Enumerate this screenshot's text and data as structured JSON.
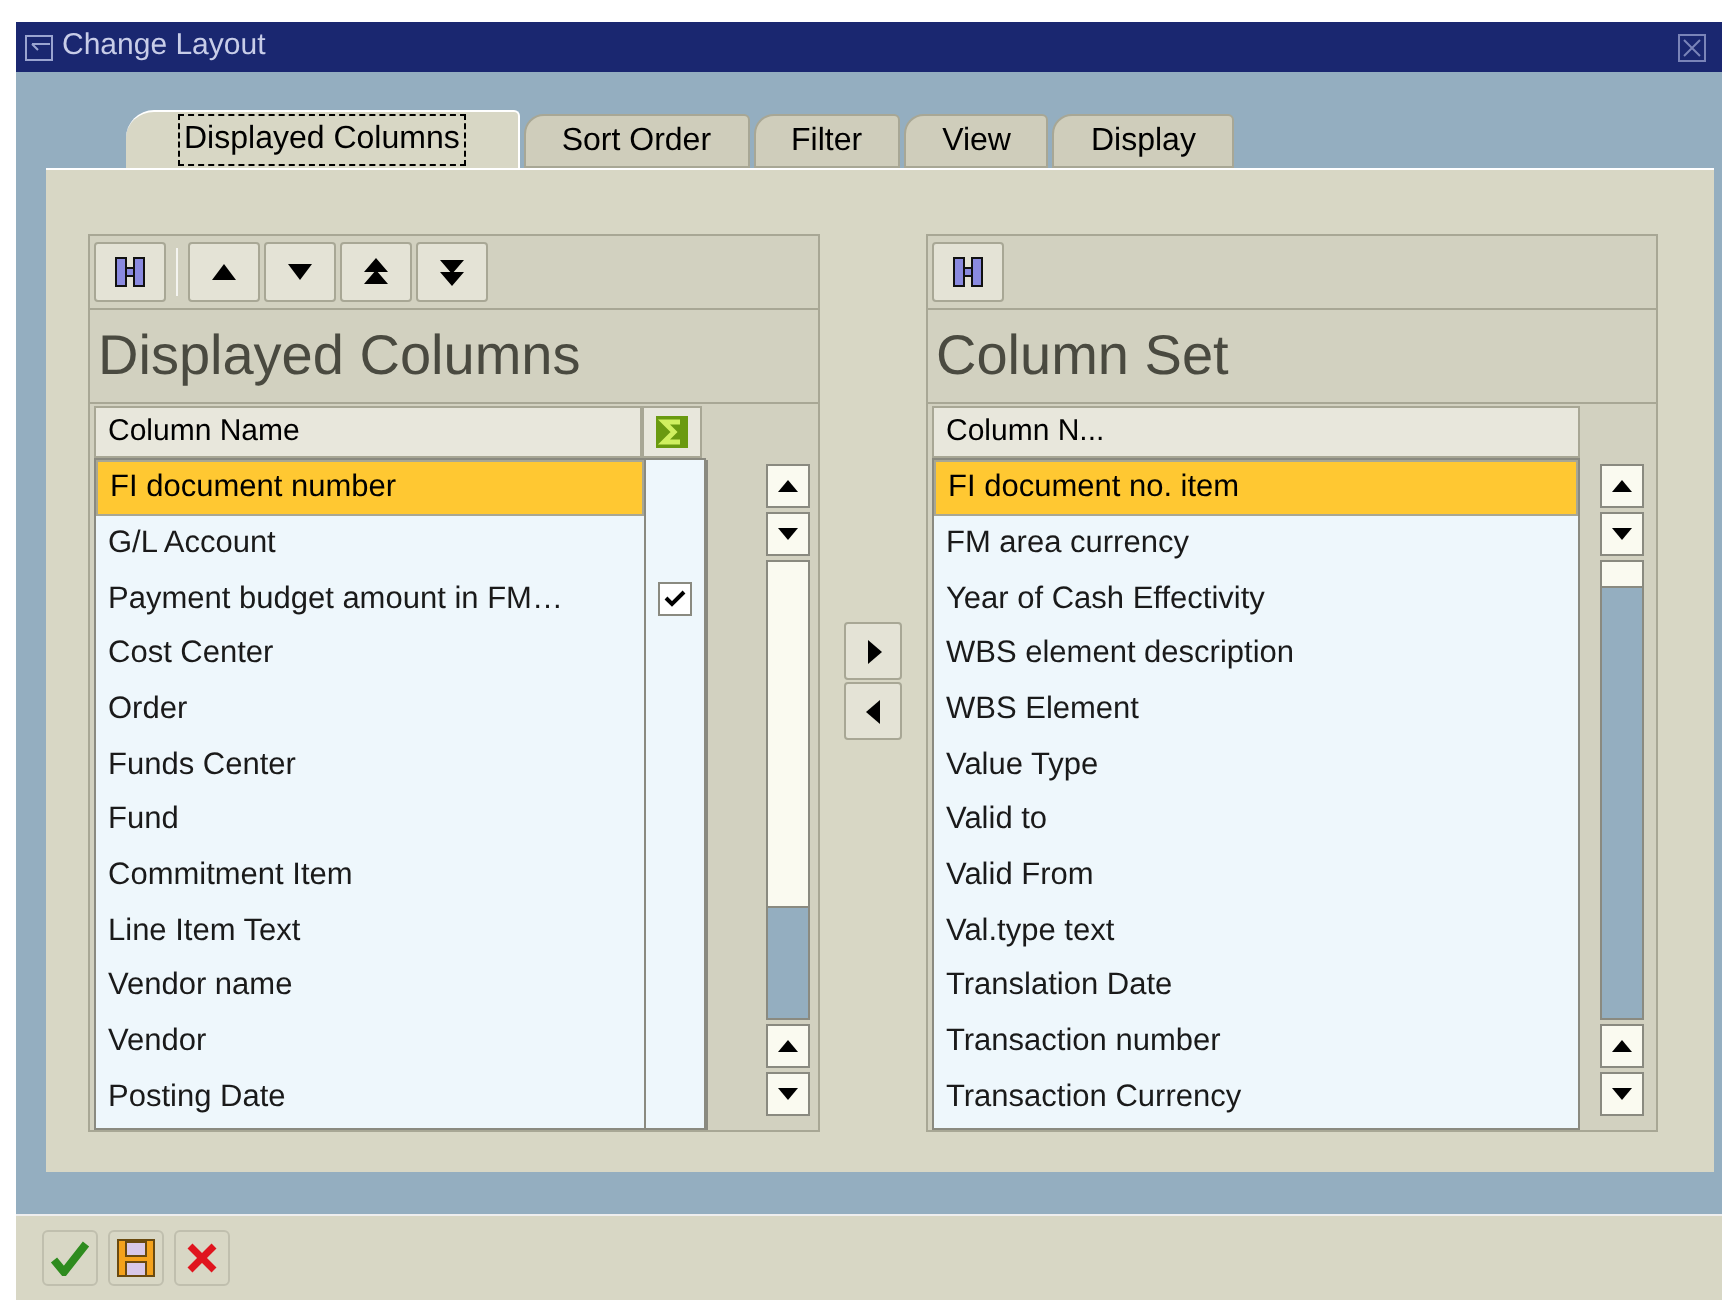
{
  "window": {
    "title": "Change Layout"
  },
  "tabs": [
    {
      "label": "Displayed Columns",
      "selected": true
    },
    {
      "label": "Sort Order",
      "selected": false
    },
    {
      "label": "Filter",
      "selected": false
    },
    {
      "label": "View",
      "selected": false
    },
    {
      "label": "Display",
      "selected": false
    }
  ],
  "displayed_columns": {
    "heading": "Displayed Columns",
    "column_header": "Column Name",
    "rows": [
      {
        "name": "FI document number",
        "selected": true,
        "total": false
      },
      {
        "name": "G/L Account",
        "selected": false,
        "total": false
      },
      {
        "name": "Payment budget amount in FM…",
        "selected": false,
        "total": true
      },
      {
        "name": "Cost Center",
        "selected": false,
        "total": false
      },
      {
        "name": "Order",
        "selected": false,
        "total": false
      },
      {
        "name": "Funds Center",
        "selected": false,
        "total": false
      },
      {
        "name": "Fund",
        "selected": false,
        "total": false
      },
      {
        "name": "Commitment Item",
        "selected": false,
        "total": false
      },
      {
        "name": "Line Item Text",
        "selected": false,
        "total": false
      },
      {
        "name": "Vendor name",
        "selected": false,
        "total": false
      },
      {
        "name": "Vendor",
        "selected": false,
        "total": false
      },
      {
        "name": "Posting Date",
        "selected": false,
        "total": false
      }
    ]
  },
  "column_set": {
    "heading": "Column Set",
    "column_header": "Column N...",
    "rows": [
      {
        "name": "FI document no. item",
        "selected": true
      },
      {
        "name": "FM area currency",
        "selected": false
      },
      {
        "name": "Year of Cash Effectivity",
        "selected": false
      },
      {
        "name": "WBS element description",
        "selected": false
      },
      {
        "name": "WBS Element",
        "selected": false
      },
      {
        "name": "Value Type",
        "selected": false
      },
      {
        "name": "Valid to",
        "selected": false
      },
      {
        "name": "Valid From",
        "selected": false
      },
      {
        "name": "Val.type text",
        "selected": false
      },
      {
        "name": "Translation Date",
        "selected": false
      },
      {
        "name": "Transaction number",
        "selected": false
      },
      {
        "name": "Transaction Currency",
        "selected": false
      }
    ]
  }
}
